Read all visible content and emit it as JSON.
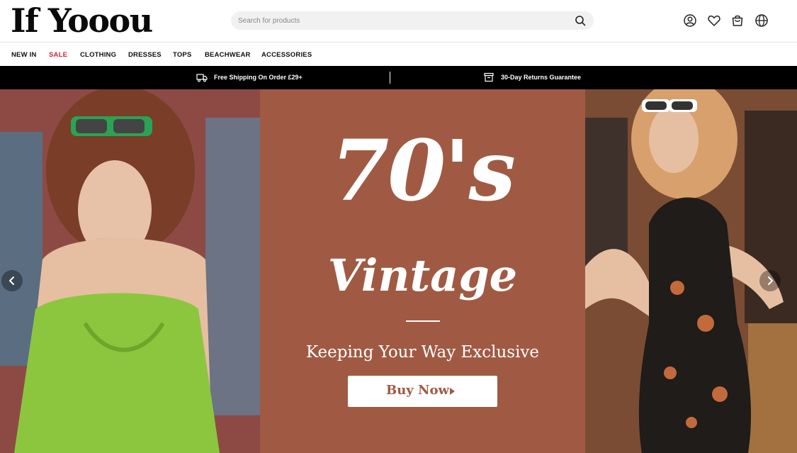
{
  "brand": {
    "logo_text": "If Yooou"
  },
  "search": {
    "placeholder": "Search for products",
    "icon": "search-icon"
  },
  "header_icons": [
    "account-icon",
    "wishlist-heart-icon",
    "bag-icon",
    "globe-icon"
  ],
  "nav": {
    "items": [
      {
        "label": "NEW IN"
      },
      {
        "label": "SALE"
      },
      {
        "label": "CLOTHING"
      },
      {
        "label": "DRESSES"
      },
      {
        "label": "TOPS"
      },
      {
        "label": "BEACHWEAR"
      },
      {
        "label": "ACCESSORIES"
      }
    ]
  },
  "promo": {
    "shipping": {
      "text": "Free Shipping On Order £29+",
      "icon": "truck-icon"
    },
    "returns": {
      "text": "30-Day Returns Guarantee",
      "icon": "return-box-icon"
    }
  },
  "hero": {
    "headline": "70's",
    "subheadline": "Vintage",
    "tagline": "Keeping Your Way Exclusive",
    "cta_label": "Buy Now",
    "prev_icon": "chevron-left-icon",
    "next_icon": "chevron-right-icon"
  },
  "colors": {
    "sale": "#d6223a",
    "hero_panel": "#a05a43",
    "promo_bar": "#000000"
  }
}
